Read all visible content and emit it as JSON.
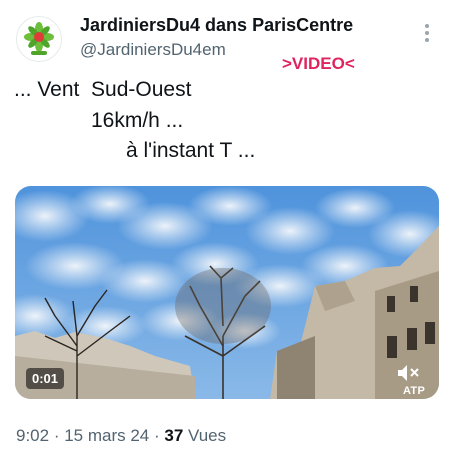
{
  "author": {
    "display_name": "JardiniersDu4 dans ParisCentre",
    "handle": "@JardiniersDu4em"
  },
  "video_tag": ">VIDEO<",
  "tweet_lines": [
    "... Vent  Sud-Ouest",
    "16km/h ...",
    "à l'instant T ..."
  ],
  "video": {
    "duration": "0:01",
    "watermark": "ATP"
  },
  "meta": {
    "time": "9:02",
    "sep1": " · ",
    "date": "15 mars 24",
    "sep2": " · ",
    "views": "37",
    "views_label": " Vues"
  },
  "colors": {
    "sky": "#5f9fe3",
    "video_tag": "#e0245e",
    "secondary_text": "#536471"
  },
  "icons": [
    "more-icon",
    "mute-icon",
    "avatar-logo"
  ]
}
